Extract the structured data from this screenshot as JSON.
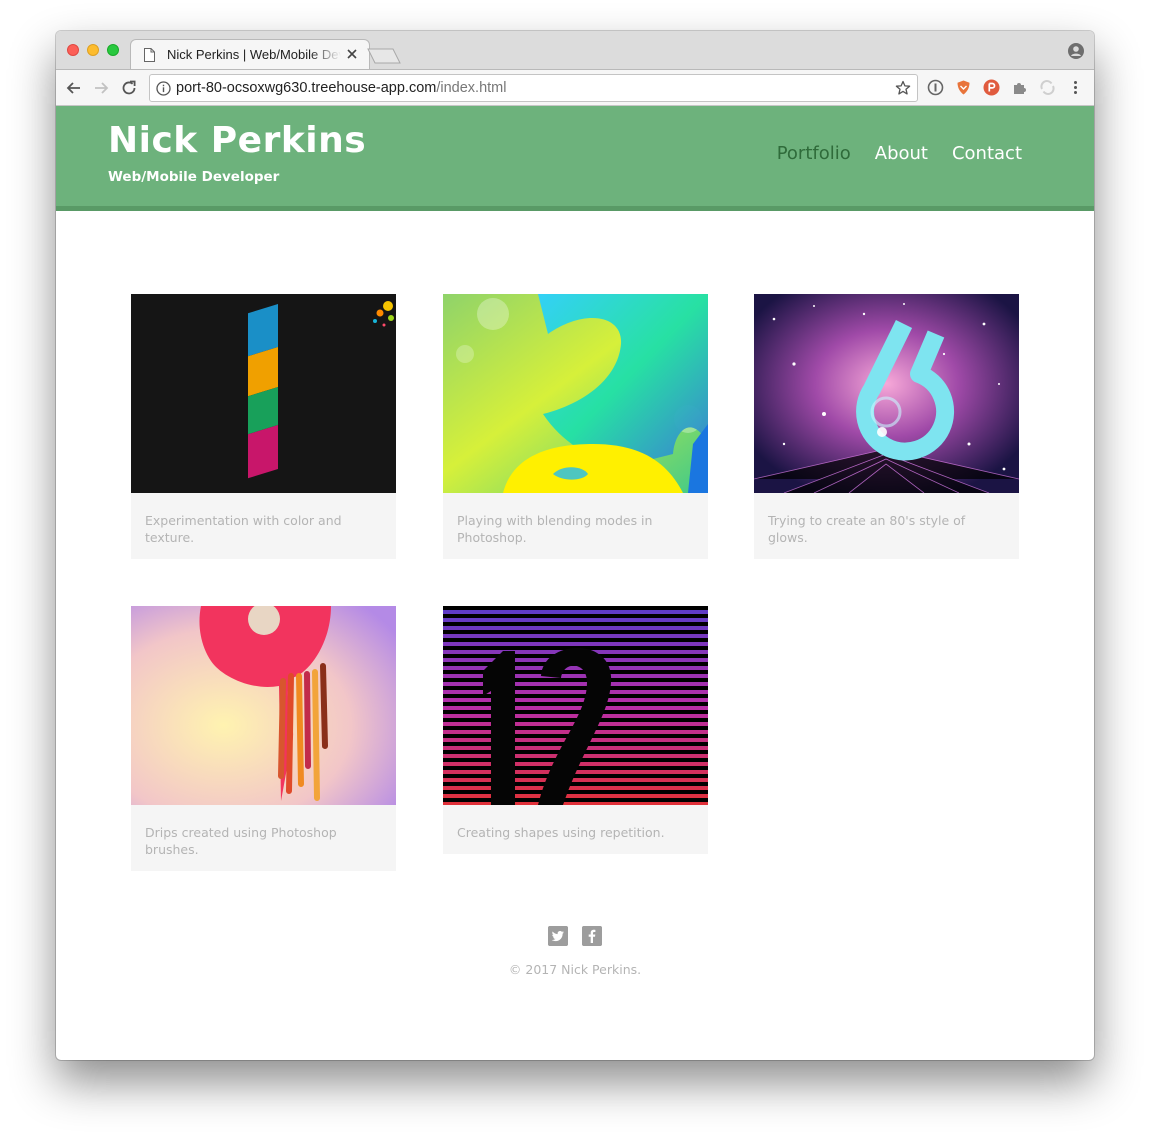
{
  "browser": {
    "tab_title": "Nick Perkins | Web/Mobile Developer",
    "url_host": "port-80-ocsoxwg630.treehouse-app.com",
    "url_path": "/index.html"
  },
  "site": {
    "title": "Nick Perkins",
    "tagline": "Web/Mobile Developer",
    "nav": [
      {
        "label": "Portfolio",
        "active": true
      },
      {
        "label": "About",
        "active": false
      },
      {
        "label": "Contact",
        "active": false
      }
    ],
    "header_color": "#6db27c",
    "active_nav_color": "#2f6b3a"
  },
  "gallery": [
    {
      "caption": "Experimentation with color and texture.",
      "art": "numeral-1-stripes"
    },
    {
      "caption": "Playing with blending modes in Photoshop.",
      "art": "numeral-2-gradient"
    },
    {
      "caption": "Trying to create an 80's style of glows.",
      "art": "numeral-6-space-glow"
    },
    {
      "caption": "Drips created using Photoshop brushes.",
      "art": "numeral-9-drips"
    },
    {
      "caption": "Creating shapes using repetition.",
      "art": "numeral-12-stripes"
    }
  ],
  "footer": {
    "social": [
      "twitter-icon",
      "facebook-icon"
    ],
    "copyright": "© 2017 Nick Perkins."
  }
}
